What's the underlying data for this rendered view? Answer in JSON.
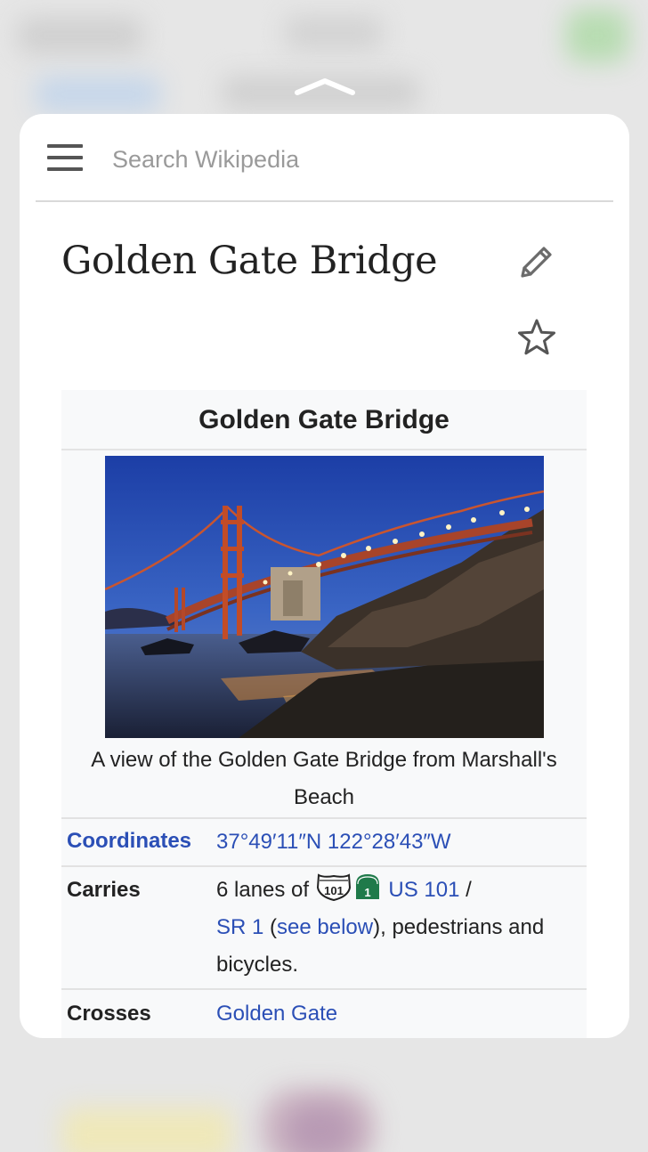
{
  "search": {
    "placeholder": "Search Wikipedia"
  },
  "article": {
    "title": "Golden Gate Bridge"
  },
  "infobox": {
    "title": "Golden Gate Bridge",
    "caption": "A view of the Golden Gate Bridge from Marshall's Beach",
    "rows": {
      "coordinates": {
        "label": "Coordinates",
        "value": "37°49′11″N 122°28′43″W"
      },
      "carries": {
        "label": "Carries",
        "prefix": "6 lanes of ",
        "us101_link": "US 101",
        "slash": " /",
        "sr1_link": "SR 1",
        "paren_open": " (",
        "see_below_link": "see below",
        "paren_close": "), pedestrians and bicycles.",
        "us_shield_number": "101",
        "ca_shield_number": "1"
      },
      "crosses": {
        "label": "Crosses",
        "value": "Golden Gate"
      }
    }
  },
  "icons": {
    "menu": "hamburger-menu-icon",
    "edit": "pencil-icon",
    "watch": "star-icon",
    "peek": "chevron-up-icon"
  },
  "colors": {
    "link": "#2b4fb6",
    "ca_shield": "#1f7a4a",
    "infobox_bg": "#f8f9fa"
  }
}
